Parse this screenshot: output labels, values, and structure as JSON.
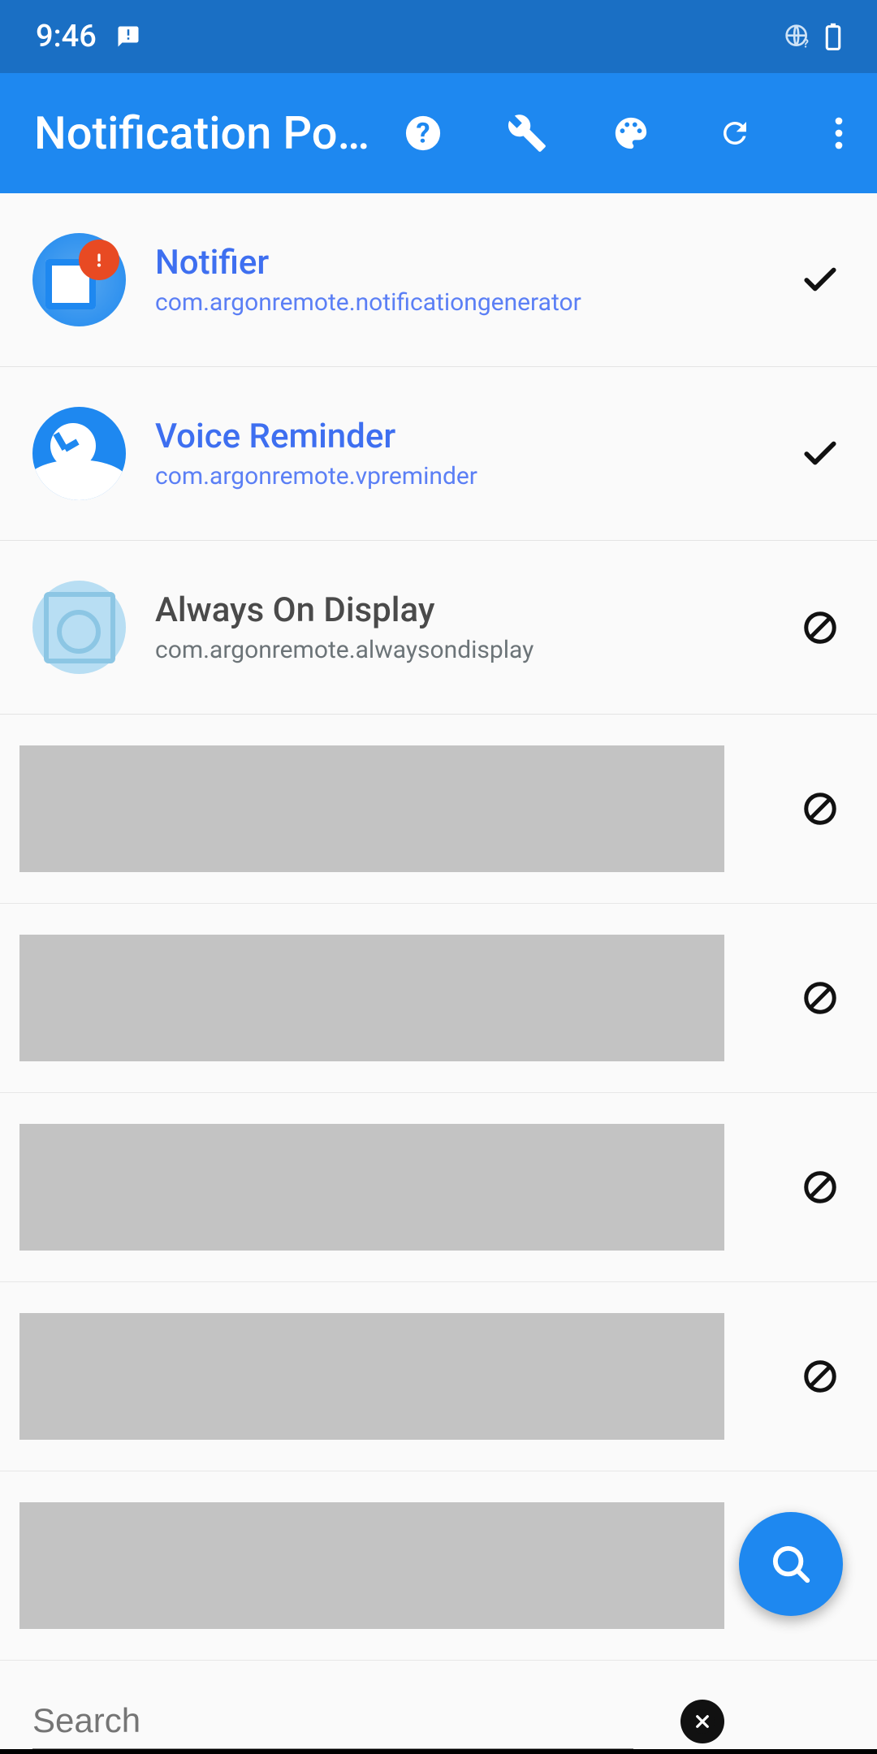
{
  "status_bar": {
    "time": "9:46"
  },
  "app_bar": {
    "title": "Notification Popup"
  },
  "apps": [
    {
      "name": "Notifier",
      "pkg": "com.argonremote.notificationgenerator",
      "enabled": true,
      "icon": "notifier"
    },
    {
      "name": "Voice Reminder",
      "pkg": "com.argonremote.vpreminder",
      "enabled": true,
      "icon": "voice"
    },
    {
      "name": "Always On Display",
      "pkg": "com.argonremote.alwaysondisplay",
      "enabled": false,
      "icon": "aod"
    }
  ],
  "placeholder_rows": 5,
  "search": {
    "placeholder": "Search",
    "value": ""
  }
}
